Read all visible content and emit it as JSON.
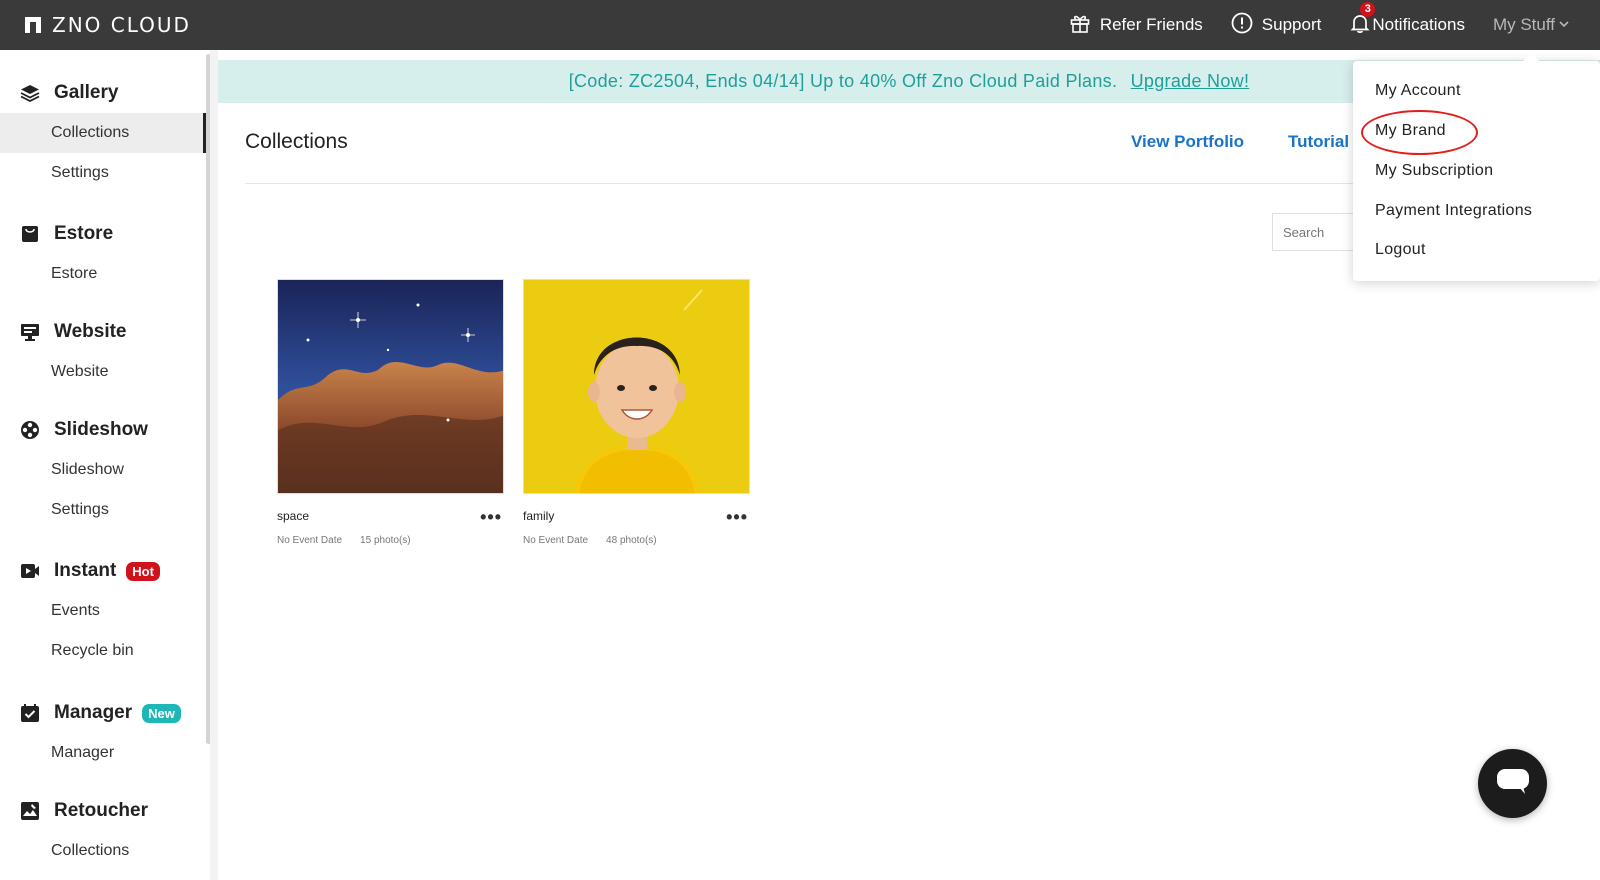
{
  "topbar": {
    "brand": "ZNO CLOUD",
    "refer": "Refer Friends",
    "support": "Support",
    "notifications": "Notifications",
    "notif_count": "3",
    "my_stuff": "My Stuff"
  },
  "sidebar": {
    "gallery": {
      "label": "Gallery",
      "items": [
        "Collections",
        "Settings"
      ]
    },
    "estore": {
      "label": "Estore",
      "items": [
        "Estore"
      ]
    },
    "website": {
      "label": "Website",
      "items": [
        "Website"
      ]
    },
    "slideshow": {
      "label": "Slideshow",
      "items": [
        "Slideshow",
        "Settings"
      ]
    },
    "instant": {
      "label": "Instant",
      "badge": "Hot",
      "items": [
        "Events",
        "Recycle bin"
      ]
    },
    "manager": {
      "label": "Manager",
      "badge": "New",
      "items": [
        "Manager"
      ]
    },
    "retoucher": {
      "label": "Retoucher",
      "items": [
        "Collections"
      ]
    }
  },
  "promo": {
    "text": "[Code: ZC2504, Ends 04/14] Up to 40% Off Zno Cloud Paid Plans.",
    "link": "Upgrade Now!"
  },
  "main": {
    "title": "Collections",
    "view_portfolio": "View Portfolio",
    "tutorial": "Tutorial",
    "search_placeholder": "Search"
  },
  "collections": [
    {
      "name": "space",
      "date": "No Event Date",
      "count": "15 photo(s)"
    },
    {
      "name": "family",
      "date": "No Event Date",
      "count": "48 photo(s)"
    }
  ],
  "dropdown": {
    "items": [
      "My Account",
      "My Brand",
      "My Subscription",
      "Payment Integrations",
      "Logout"
    ]
  },
  "colors": {
    "topbar": "#3a3a3a",
    "accent_link": "#1b73c6",
    "promo_bg": "#d6eeec",
    "promo_text": "#1f9f9a",
    "badge_hot": "#d0121b",
    "badge_new": "#1fb7b5"
  }
}
